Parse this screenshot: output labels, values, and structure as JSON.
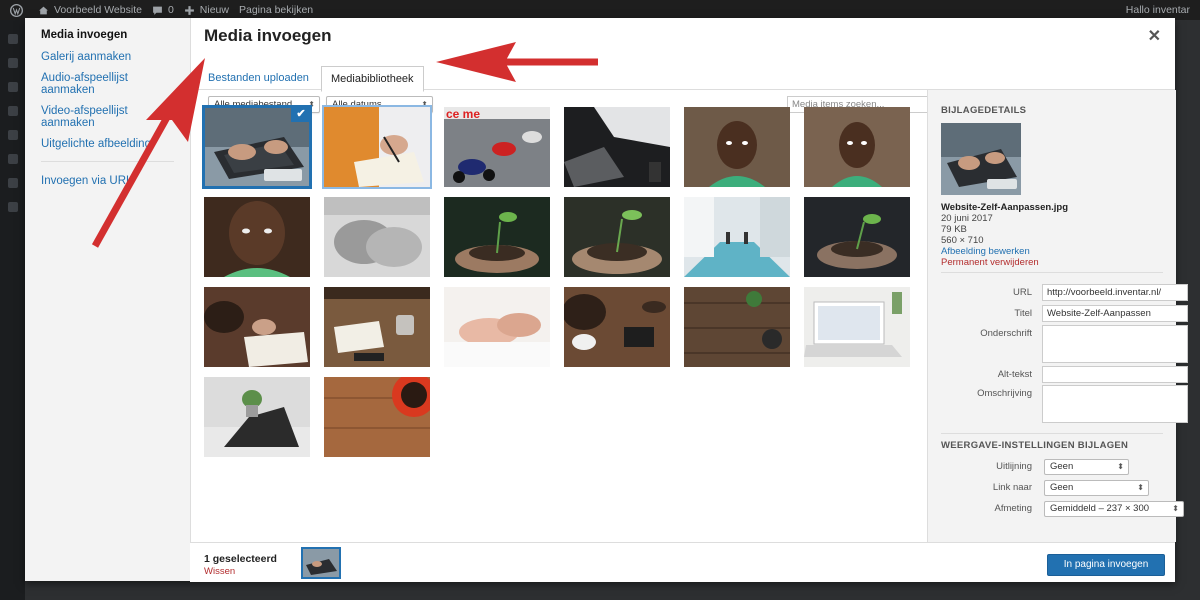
{
  "admin_bar": {
    "site_name": "Voorbeeld Website",
    "comments_count": "0",
    "new_label": "Nieuw",
    "view_page": "Pagina bekijken",
    "howdy": "Hallo inventar"
  },
  "modal": {
    "title": "Media invoegen",
    "close_icon": "close-icon",
    "menu": [
      {
        "label": "Media invoegen",
        "active": true
      },
      {
        "label": "Galerij aanmaken"
      },
      {
        "label": "Audio-afspeellijst aanmaken"
      },
      {
        "label": "Video-afspeellijst aanmaken"
      },
      {
        "label": "Uitgelichte afbeelding"
      },
      {
        "label": "Invoegen via URL"
      }
    ],
    "tabs": {
      "upload": "Bestanden uploaden",
      "library": "Mediabibliotheek"
    },
    "filters": {
      "type": "Alle mediabestand",
      "date": "Alle datums",
      "search_placeholder": "Media items zoeken..."
    },
    "grid": {
      "items": [
        {
          "subject": "laptop-hands",
          "selected": true
        },
        {
          "subject": "writing-notes",
          "selected": false
        },
        {
          "subject": "motorcycle-race",
          "selected": false
        },
        {
          "subject": "laptop-desk-dark",
          "selected": false
        },
        {
          "subject": "child-portrait",
          "selected": false
        },
        {
          "subject": "child-portrait",
          "selected": false
        },
        {
          "subject": "child-closeup",
          "selected": false
        },
        {
          "subject": "holding-hands",
          "selected": false
        },
        {
          "subject": "seedling-hands",
          "selected": false
        },
        {
          "subject": "seedling-hands",
          "selected": false
        },
        {
          "subject": "office-hallway",
          "selected": false
        },
        {
          "subject": "seedling-hands",
          "selected": false
        },
        {
          "subject": "writing-desk",
          "selected": false
        },
        {
          "subject": "notebook-coffee",
          "selected": false
        },
        {
          "subject": "handshake",
          "selected": false
        },
        {
          "subject": "desk-coffee",
          "selected": false
        },
        {
          "subject": "wood-desk-top",
          "selected": false
        },
        {
          "subject": "laptop-white",
          "selected": false
        },
        {
          "subject": "laptop-plant",
          "selected": false
        },
        {
          "subject": "coffee-cup-wood",
          "selected": false
        }
      ]
    },
    "details": {
      "heading": "BIJLAGEDETAILS",
      "filename": "Website-Zelf-Aanpassen.jpg",
      "date": "20 juni 2017",
      "size": "79 KB",
      "dimensions": "560 × 710",
      "edit_link": "Afbeelding bewerken",
      "delete_link": "Permanent verwijderen",
      "fields": {
        "url_label": "URL",
        "url_value": "http://voorbeeld.inventar.nl/",
        "title_label": "Titel",
        "title_value": "Website-Zelf-Aanpassen",
        "caption_label": "Onderschrift",
        "alt_label": "Alt-tekst",
        "description_label": "Omschrijving"
      },
      "display_heading": "WEERGAVE-INSTELLINGEN BIJLAGEN",
      "display": {
        "align_label": "Uitlijning",
        "align_value": "Geen",
        "link_label": "Link naar",
        "link_value": "Geen",
        "size_label": "Afmeting",
        "size_value": "Gemiddeld – 237 × 300"
      }
    },
    "footer": {
      "count": "1 geselecteerd",
      "clear": "Wissen",
      "insert_button": "In pagina invoegen"
    }
  },
  "colors": {
    "accent": "#2271b1",
    "danger": "#b32d2e",
    "annotation_arrow": "#d32f2f"
  }
}
